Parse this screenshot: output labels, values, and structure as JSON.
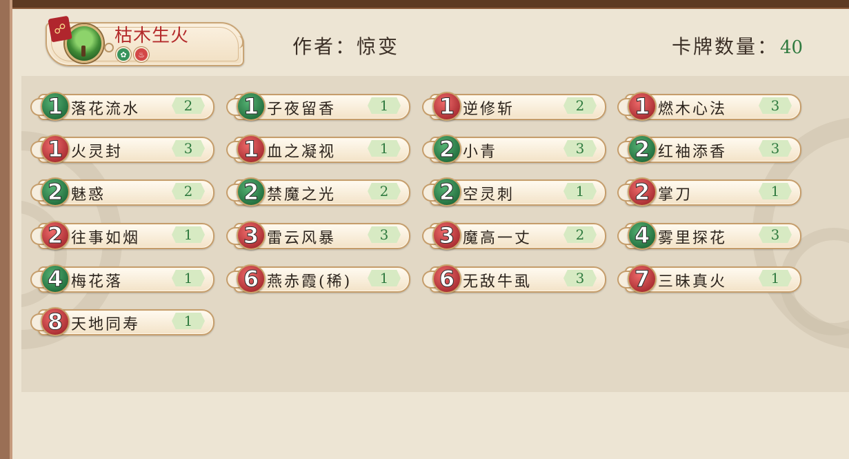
{
  "deck": {
    "name": "枯木生火",
    "link_icon": "chain-link-icon",
    "avatar_icon": "tree-icon",
    "elements": [
      "wood-element-icon",
      "fire-element-icon"
    ]
  },
  "author_label": "作者：惊变",
  "card_count": {
    "label": "卡牌数量：",
    "value": "40"
  },
  "colors": {
    "green_cost": "#2f8a4a",
    "red_cost": "#c8393c",
    "qty_text": "#2f7a3f",
    "deck_name": "#b42b2b"
  },
  "cards": [
    {
      "cost": "1",
      "color": "green",
      "name": "落花流水",
      "qty": "2"
    },
    {
      "cost": "1",
      "color": "green",
      "name": "子夜留香",
      "qty": "1"
    },
    {
      "cost": "1",
      "color": "red",
      "name": "逆修斩",
      "qty": "2"
    },
    {
      "cost": "1",
      "color": "red",
      "name": "燃木心法",
      "qty": "3"
    },
    {
      "cost": "1",
      "color": "red",
      "name": "火灵封",
      "qty": "3"
    },
    {
      "cost": "1",
      "color": "red",
      "name": "血之凝视",
      "qty": "1"
    },
    {
      "cost": "2",
      "color": "green",
      "name": "小青",
      "qty": "3"
    },
    {
      "cost": "2",
      "color": "green",
      "name": "红袖添香",
      "qty": "3"
    },
    {
      "cost": "2",
      "color": "green",
      "name": "魅惑",
      "qty": "2"
    },
    {
      "cost": "2",
      "color": "green",
      "name": "禁魔之光",
      "qty": "2"
    },
    {
      "cost": "2",
      "color": "green",
      "name": "空灵刺",
      "qty": "1"
    },
    {
      "cost": "2",
      "color": "red",
      "name": "掌刀",
      "qty": "1"
    },
    {
      "cost": "2",
      "color": "red",
      "name": "往事如烟",
      "qty": "1"
    },
    {
      "cost": "3",
      "color": "red",
      "name": "雷云风暴",
      "qty": "3"
    },
    {
      "cost": "3",
      "color": "red",
      "name": "魔高一丈",
      "qty": "2"
    },
    {
      "cost": "4",
      "color": "green",
      "name": "雾里探花",
      "qty": "3"
    },
    {
      "cost": "4",
      "color": "green",
      "name": "梅花落",
      "qty": "1"
    },
    {
      "cost": "6",
      "color": "red",
      "name": "燕赤霞(稀)",
      "qty": "1"
    },
    {
      "cost": "6",
      "color": "red",
      "name": "无敌牛虱",
      "qty": "3"
    },
    {
      "cost": "7",
      "color": "red",
      "name": "三昧真火",
      "qty": "1"
    },
    {
      "cost": "8",
      "color": "red",
      "name": "天地同寿",
      "qty": "1"
    }
  ]
}
